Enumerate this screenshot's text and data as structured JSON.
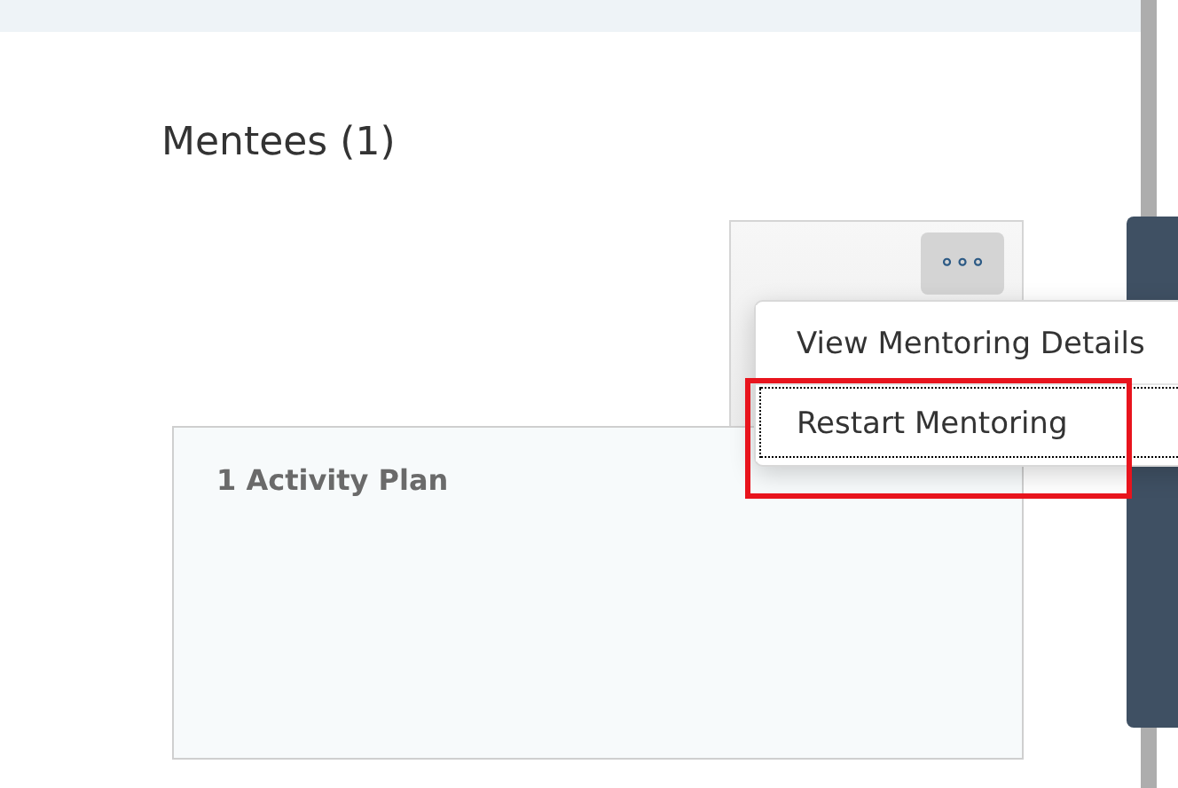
{
  "section_title": "Mentees (1)",
  "mentee_card": {
    "more_button": "∘∘∘"
  },
  "activity_card": {
    "title": "1 Activity Plan"
  },
  "context_menu": {
    "items": [
      {
        "label": "View Mentoring Details",
        "selected": false
      },
      {
        "label": "Restart Mentoring",
        "selected": true
      }
    ]
  }
}
